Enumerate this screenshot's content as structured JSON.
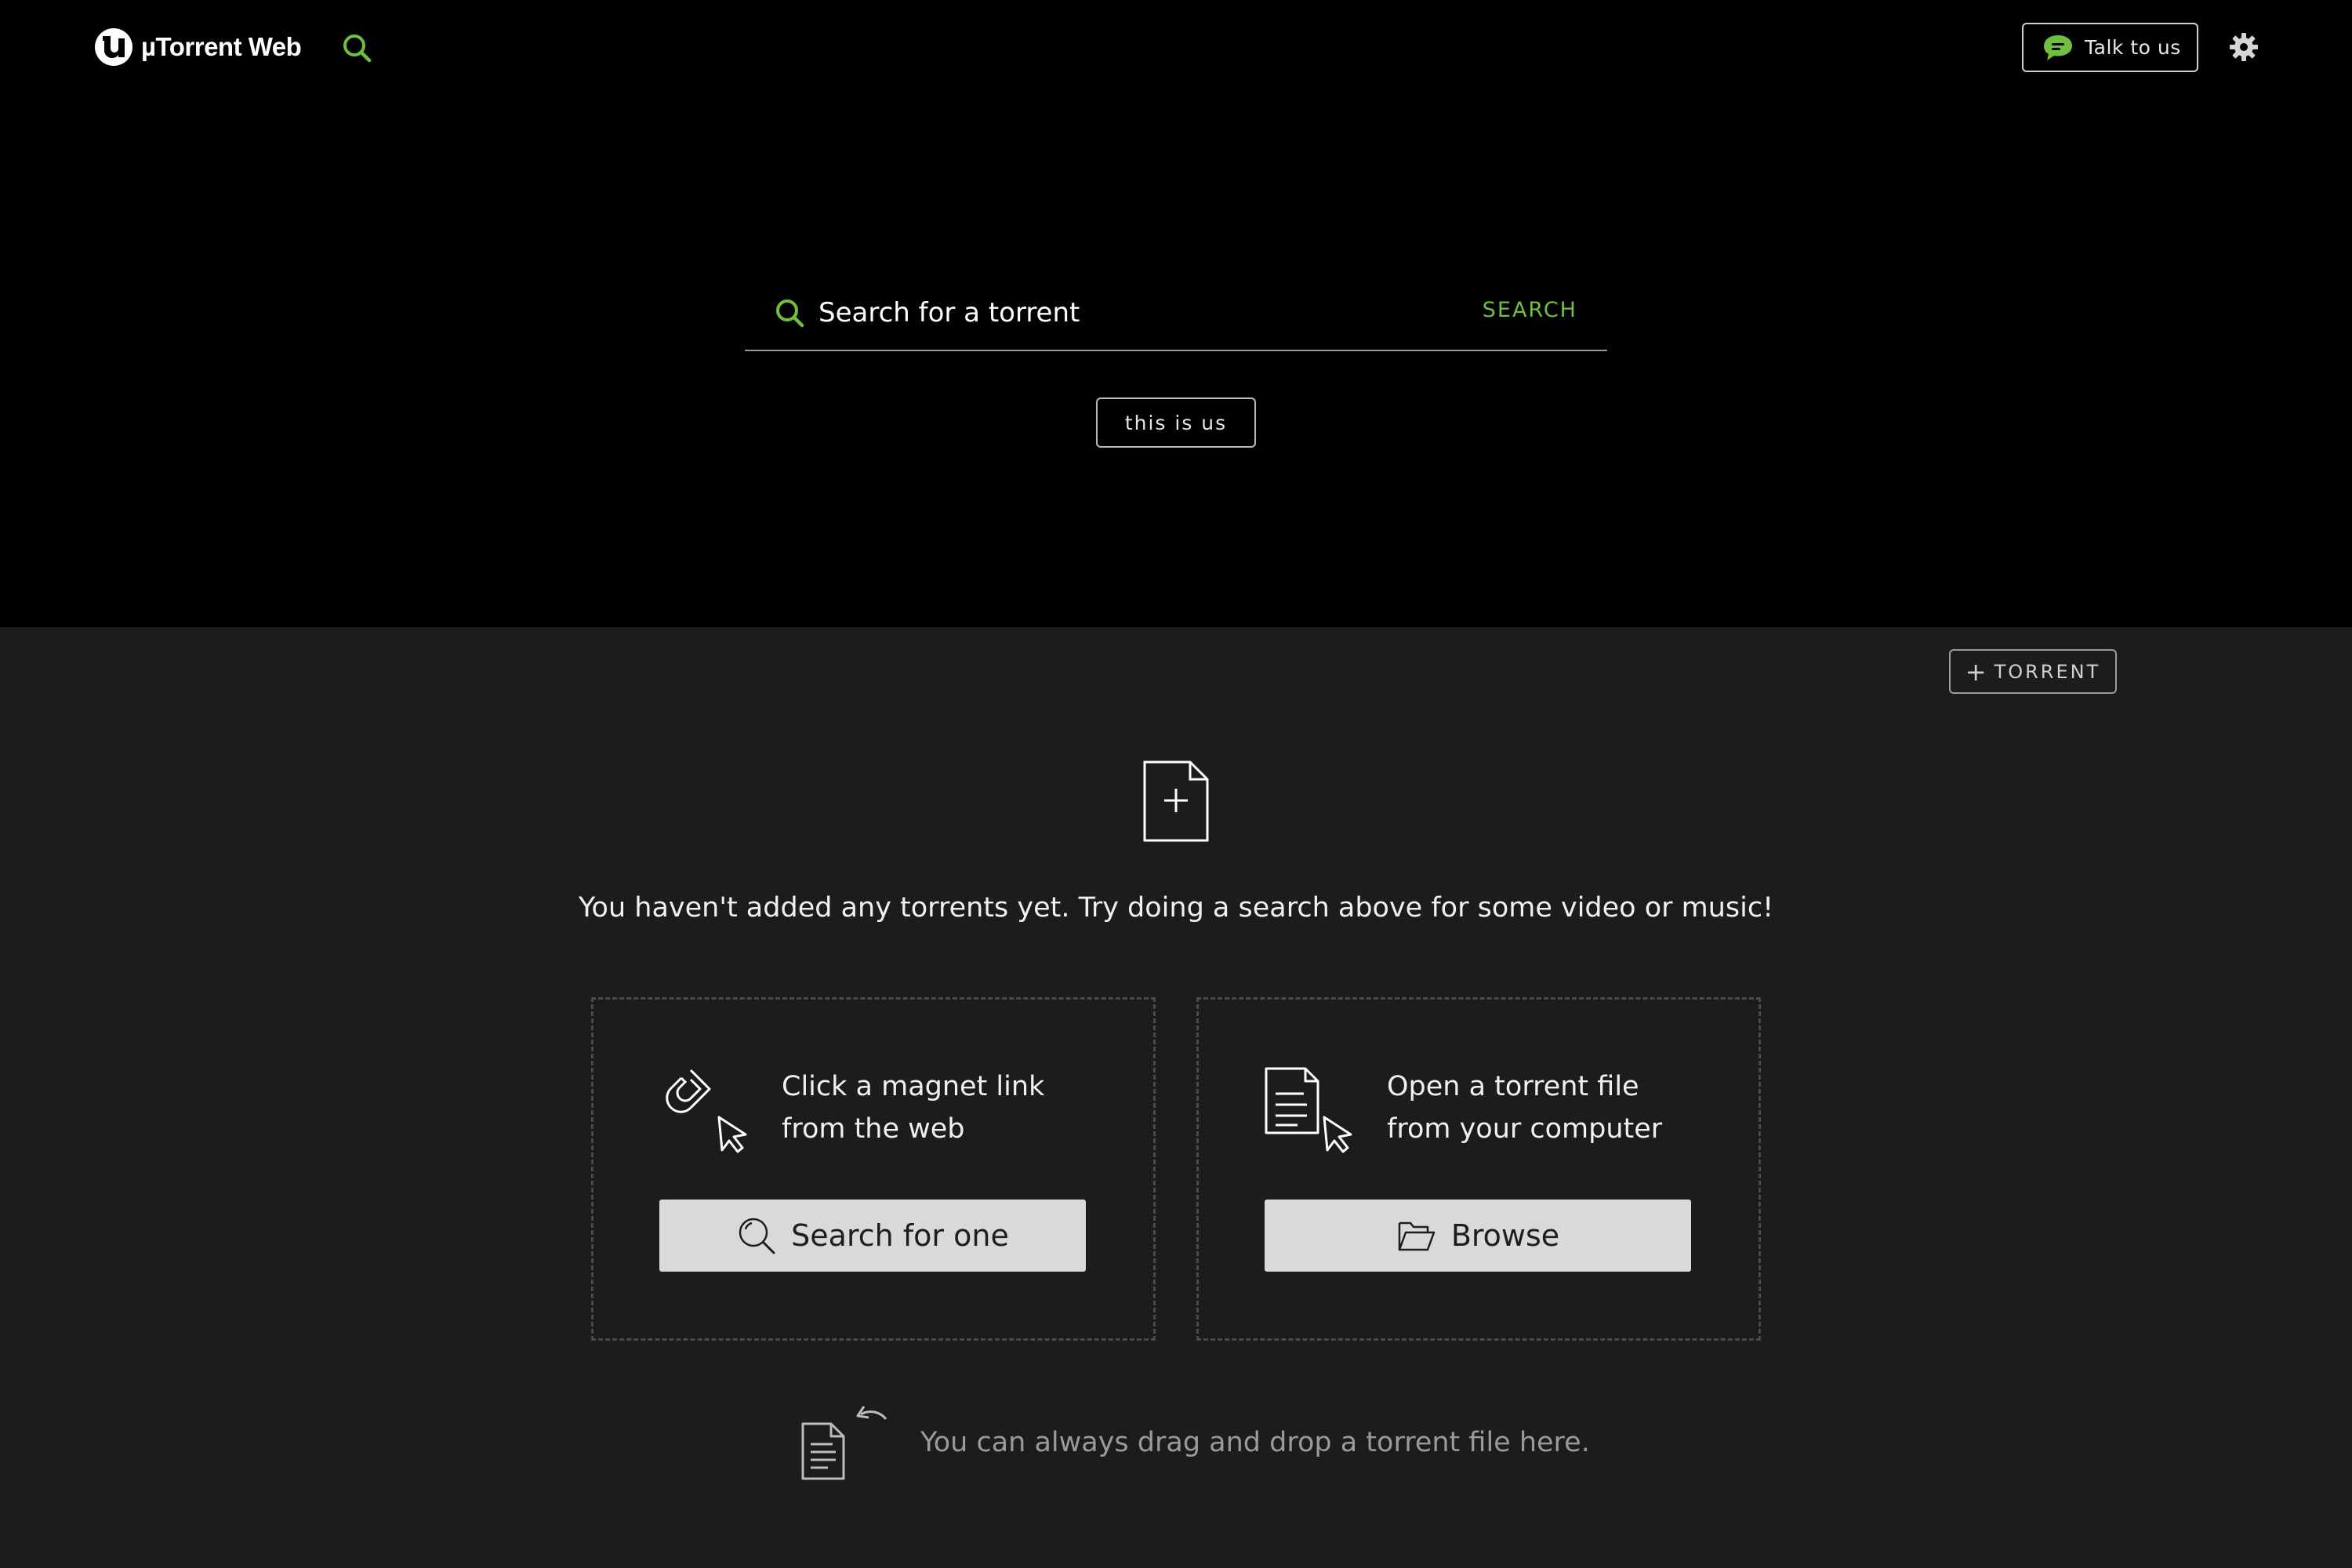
{
  "header": {
    "app_name": "µTorrent Web",
    "talk_label": "Talk to us",
    "icons": {
      "logo": "utorrent-logo-icon",
      "search": "search-icon",
      "chat": "chat-bubble-icon",
      "settings": "gear-icon"
    }
  },
  "search": {
    "placeholder": "Search for a torrent",
    "value": "",
    "submit_label": "SEARCH",
    "about_label": "this is us"
  },
  "torrents": {
    "add_label": "TORRENT",
    "add_prefix": "+",
    "empty_message": "You haven't added any torrents yet. Try doing a search above for some video or music!",
    "cards": [
      {
        "line1": "Click a magnet link",
        "line2": "from the web",
        "button_label": "Search for one",
        "icon": "magnet-cursor-icon",
        "button_icon": "search-icon"
      },
      {
        "line1": "Open a torrent file",
        "line2": "from your computer",
        "button_label": "Browse",
        "icon": "file-cursor-icon",
        "button_icon": "folder-open-icon"
      }
    ],
    "drag_hint": "You can always drag and drop a torrent file here."
  },
  "colors": {
    "accent": "#6fbf40",
    "top_background": "#000000",
    "bottom_background": "#1c1c1c",
    "button_background": "#d9d9d9"
  }
}
